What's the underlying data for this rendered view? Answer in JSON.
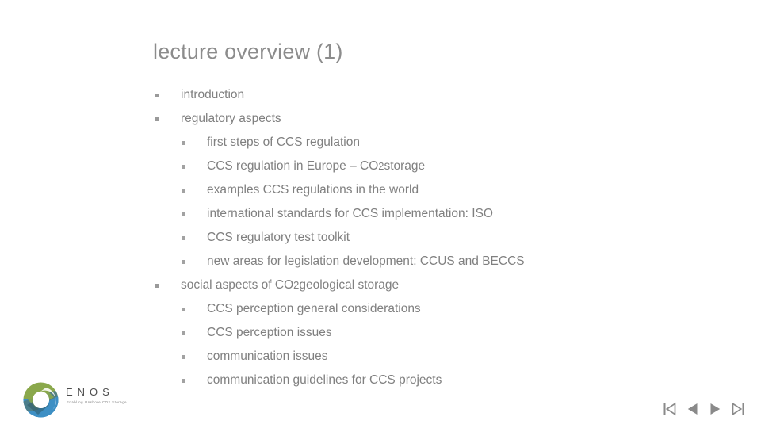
{
  "slide": {
    "title": "lecture overview (1)",
    "text_color": "#808080",
    "title_color": "#8c8c8c",
    "background": "#ffffff"
  },
  "outline": [
    {
      "level": 1,
      "bullet": "square-bullet",
      "text": "introduction"
    },
    {
      "level": 1,
      "bullet": "square-bullet",
      "text": "regulatory aspects"
    },
    {
      "level": 2,
      "bullet": "square-bullet",
      "text": "first steps of CCS regulation"
    },
    {
      "level": 2,
      "bullet": "square-bullet",
      "text_pre": "CCS regulation in Europe – CO",
      "sub": "2",
      "text_post": " storage"
    },
    {
      "level": 2,
      "bullet": "square-bullet",
      "text": "examples CCS regulations in the world"
    },
    {
      "level": 2,
      "bullet": "square-bullet",
      "text": "international standards for CCS implementation: ISO"
    },
    {
      "level": 2,
      "bullet": "square-bullet",
      "text": "CCS regulatory test toolkit"
    },
    {
      "level": 2,
      "bullet": "square-bullet",
      "text": "new areas for legislation development: CCUS and BECCS"
    },
    {
      "level": 1,
      "bullet": "square-bullet",
      "text_pre": "social aspects of CO",
      "sub": "2",
      "text_post": " geological storage"
    },
    {
      "level": 2,
      "bullet": "square-bullet",
      "text": "CCS perception general considerations"
    },
    {
      "level": 2,
      "bullet": "square-bullet",
      "text": "CCS perception issues"
    },
    {
      "level": 2,
      "bullet": "square-bullet",
      "text": "communication issues"
    },
    {
      "level": 2,
      "bullet": "square-bullet",
      "text": "communication guidelines for CCS projects"
    }
  ],
  "logo": {
    "icon": "enos-ring-logo",
    "wordmark": "ENOS",
    "tagline": "Enabling Onshore CO2 Storage",
    "colors": {
      "green": "#8aa84b",
      "blue": "#3d8fc4",
      "teal": "#4d7d86",
      "dark": "#2f5a66"
    }
  },
  "navigation": {
    "buttons": [
      {
        "name": "first-slide-button",
        "icon": "skip-to-start-icon",
        "label": "First"
      },
      {
        "name": "previous-slide-button",
        "icon": "play-back-icon",
        "label": "Previous"
      },
      {
        "name": "next-slide-button",
        "icon": "play-forward-icon",
        "label": "Next"
      },
      {
        "name": "last-slide-button",
        "icon": "skip-to-end-icon",
        "label": "Last"
      }
    ],
    "color": "#8a8a8a"
  }
}
